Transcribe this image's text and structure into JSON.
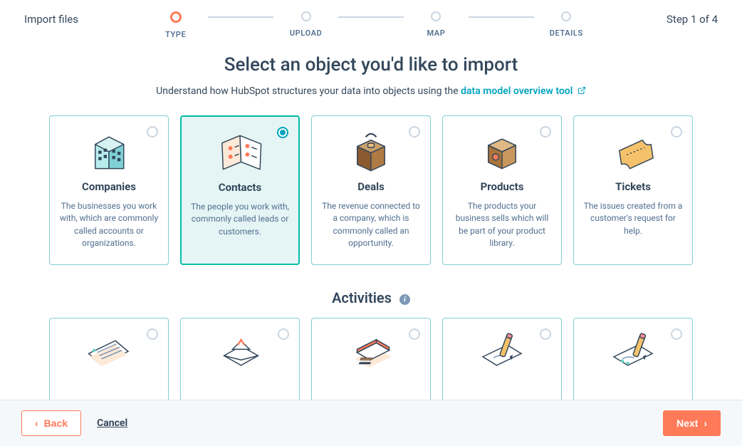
{
  "header": {
    "page_label": "Import files",
    "step_label": "Step 1 of 4"
  },
  "progress": [
    {
      "label": "TYPE",
      "active": true
    },
    {
      "label": "UPLOAD",
      "active": false
    },
    {
      "label": "MAP",
      "active": false
    },
    {
      "label": "DETAILS",
      "active": false
    }
  ],
  "main": {
    "title": "Select an object you'd like to import",
    "subtitle_pre": "Understand how HubSpot structures your data into objects using the ",
    "subtitle_link": "data model overview tool"
  },
  "objects": [
    {
      "title": "Companies",
      "desc": "The businesses you work with, which are commonly called accounts or organizations.",
      "selected": false
    },
    {
      "title": "Contacts",
      "desc": "The people you work with, commonly called leads or customers.",
      "selected": true
    },
    {
      "title": "Deals",
      "desc": "The revenue connected to a company, which is commonly called an opportunity.",
      "selected": false
    },
    {
      "title": "Products",
      "desc": "The products your business sells which will be part of your product library.",
      "selected": false
    },
    {
      "title": "Tickets",
      "desc": "The issues created from a customer's request for help.",
      "selected": false
    }
  ],
  "section2": {
    "title": "Activities"
  },
  "footer": {
    "back": "Back",
    "cancel": "Cancel",
    "next": "Next"
  }
}
